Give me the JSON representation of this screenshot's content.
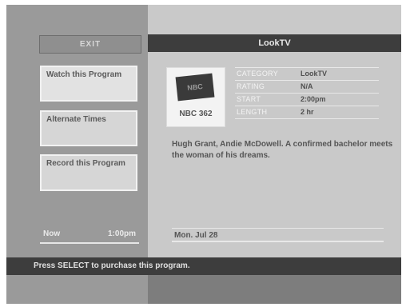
{
  "header": {
    "exit_label": "EXIT",
    "title": "LookTV"
  },
  "menu": [
    {
      "label": "Watch this Program"
    },
    {
      "label": "Alternate Times"
    },
    {
      "label": "Record this Program"
    }
  ],
  "clock": {
    "day": "Now",
    "time": "1:00pm"
  },
  "channel": {
    "logo_text": "NBC",
    "name": "NBC 362"
  },
  "info": [
    {
      "label": "CATEGORY",
      "value": "LookTV"
    },
    {
      "label": "RATING",
      "value": "N/A"
    },
    {
      "label": "START",
      "value": "2:00pm"
    },
    {
      "label": "LENGTH",
      "value": "2 hr"
    }
  ],
  "description": "Hugh Grant, Andie McDowell. A confirmed bachelor meets the woman of his dreams.",
  "date": "Mon. Jul 28",
  "status": "Press SELECT to purchase this program."
}
